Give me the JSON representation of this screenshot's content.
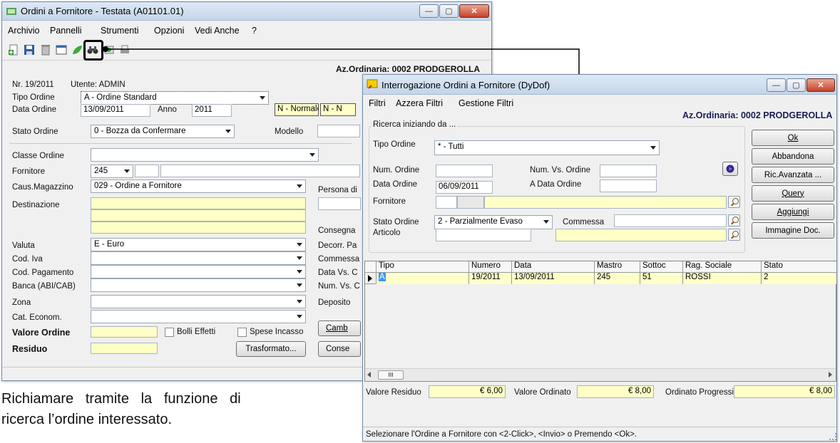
{
  "win1": {
    "title": "Ordini a Fornitore -  Testata  (A01101.01)",
    "menu": [
      "Archivio",
      "Pannelli",
      "Strumenti",
      "Opzioni",
      "Vedi Anche",
      "?"
    ],
    "company": "Az.Ordinaria: 0002 PRODGEROLLA",
    "nr_label": "Nr. 19/2011",
    "utente_label": "Utente: ADMIN",
    "tipo_ordine_label": "Tipo Ordine",
    "tipo_ordine_value": "A - Ordine Standard",
    "data_ordine_label": "Data Ordine",
    "data_ordine_value": "13/09/2011",
    "anno_label": "Anno",
    "anno_value": "2011",
    "normale_value": "N - Normale",
    "normale2_value": "N - N",
    "stato_ordine_label": "Stato Ordine",
    "stato_ordine_value": "0 - Bozza da Confermare",
    "modello_label": "Modello",
    "classe_ordine_label": "Classe Ordine",
    "fornitore_label": "Fornitore",
    "fornitore_value": "245",
    "caus_magazzino_label": "Caus.Magazzino",
    "caus_magazzino_value": "029 - Ordine a Fornitore",
    "persona_label": "Persona di",
    "destinazione_label": "Destinazione",
    "consegna_label": "Consegna",
    "valuta_label": "Valuta",
    "valuta_value": "E - Euro",
    "decorr_label": "Decorr. Pa",
    "cod_iva_label": "Cod. Iva",
    "commessa_label": "Commessa",
    "cod_pagamento_label": "Cod. Pagamento",
    "data_vs_label": "Data Vs. C",
    "banca_label": "Banca (ABI/CAB)",
    "num_vs_label": "Num. Vs. C",
    "zona_label": "Zona",
    "deposito_label": "Deposito",
    "cat_econom_label": "Cat. Econom.",
    "valore_ordine_label": "Valore Ordine",
    "bolli_label": "Bolli Effetti",
    "spese_label": "Spese Incasso",
    "cambia_label": "Camb",
    "residuo_label": "Residuo",
    "trasformato_label": "Trasformato...",
    "conse_label": "Conse"
  },
  "win2": {
    "title": "Interrogazione Ordini a Fornitore (DyDof)",
    "menu": [
      "Filtri",
      "Azzera Filtri",
      "Gestione Filtri"
    ],
    "company": "Az.Ordinaria: 0002 PRODGEROLLA",
    "group_label": "Ricerca iniziando da ...",
    "tipo_ordine_label": "Tipo Ordine",
    "tipo_ordine_value": "* - Tutti",
    "num_ordine_label": "Num. Ordine",
    "num_vs_ordine_label": "Num. Vs. Ordine",
    "data_ordine_label": "Data Ordine",
    "data_ordine_value": "06/09/2011",
    "a_data_ordine_label": "A Data Ordine",
    "fornitore_label": "Fornitore",
    "stato_ordine_label": "Stato Ordine",
    "stato_ordine_value": "2 - Parzialmente Evaso",
    "commessa_label": "Commessa",
    "articolo_label": "Articolo",
    "buttons": {
      "ok": "Ok",
      "abbandona": "Abbandona",
      "ric_avanzata": "Ric.Avanzata ...",
      "query": "Query",
      "aggiungi": "Aggiungi",
      "immagine_doc": "Immagine Doc."
    },
    "grid": {
      "columns": [
        "Tipo",
        "Numero",
        "Data",
        "Mastro",
        "Sottoc",
        "Rag. Sociale",
        "Stato"
      ],
      "rows": [
        [
          "A",
          "19/2011",
          "13/09/2011",
          "245",
          "51",
          "ROSSI",
          "2"
        ]
      ]
    },
    "scroll_thumb": "III",
    "valore_residuo_label": "Valore Residuo",
    "valore_residuo_value": "€ 6,00",
    "valore_ordinato_label": "Valore Ordinato",
    "valore_ordinato_value": "€ 8,00",
    "ordinato_progressivo_label": "Ordinato Progressivo",
    "ordinato_progressivo_value": "€ 8,00",
    "status_bar": "Selezionare l'Ordine a Fornitore con <2-Click>, <Invio> o Premendo <Ok>."
  },
  "caption": {
    "line1": "Richiamare   tramite   la   funzione   di",
    "line2": "ricerca l’ordine interessato."
  },
  "colors": {
    "highlight_yellow": "#ffffc6",
    "title_blue": "#c4d5ea"
  }
}
